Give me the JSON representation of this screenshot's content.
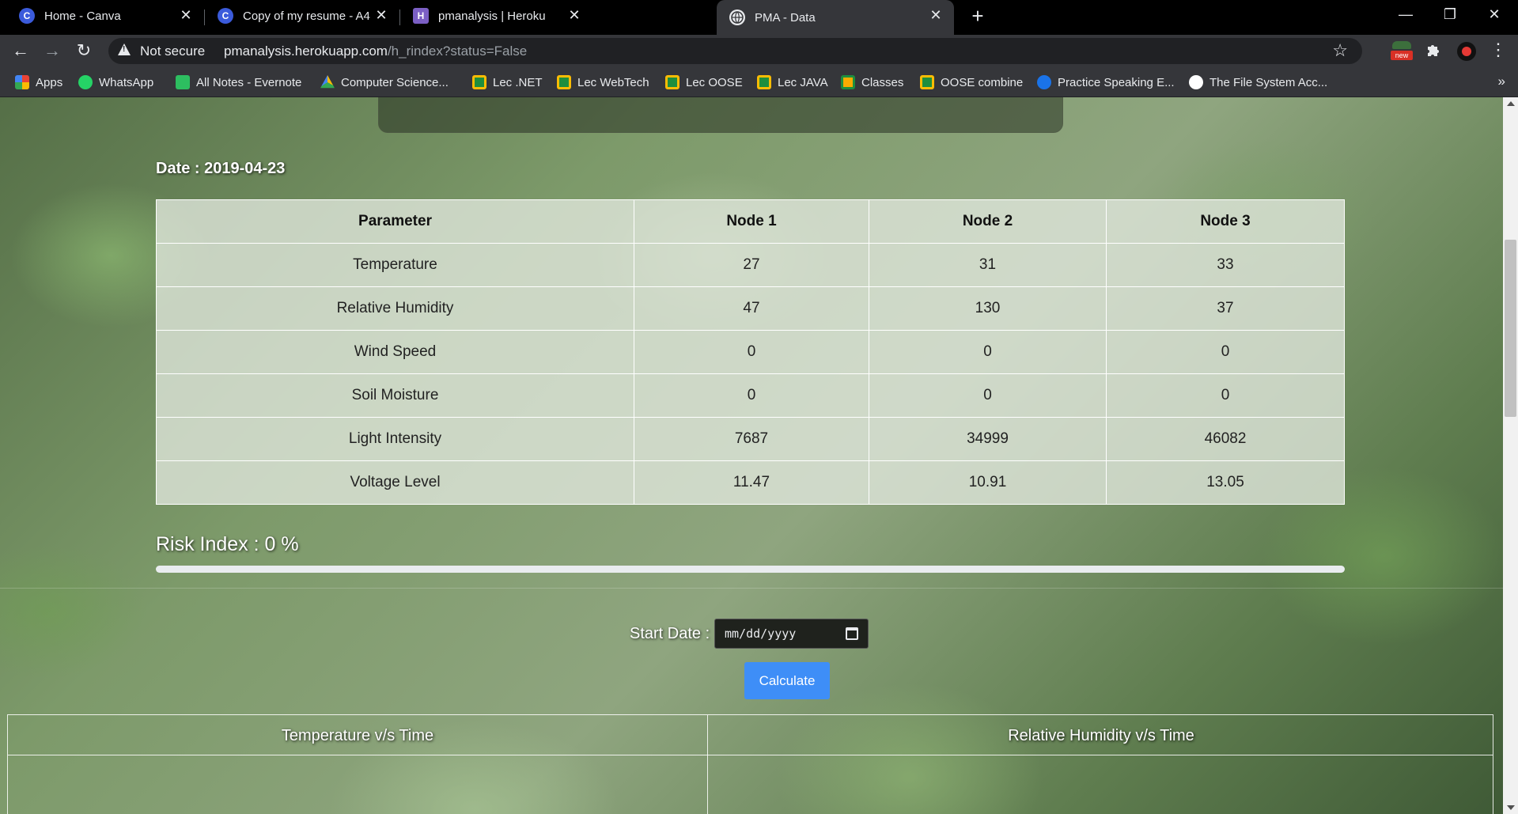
{
  "browser": {
    "tabs": [
      {
        "title": "Home - Canva",
        "favicon": "canva-icon",
        "color": "#3b5bdb",
        "letter": "C"
      },
      {
        "title": "Copy of my resume - A4",
        "favicon": "canva-icon",
        "color": "#3b5bdb",
        "letter": "C"
      },
      {
        "title": "pmanalysis | Heroku",
        "favicon": "heroku-icon",
        "color": "#7b5fc4",
        "letter": "H"
      },
      {
        "title": "PMA - Data",
        "favicon": "globe-icon",
        "color": "#5f6368",
        "letter": ""
      }
    ],
    "active_tab": 3,
    "security_label": "Not secure",
    "url_host": "pmanalysis.herokuapp.com",
    "url_path": "/h_rindex?status=False",
    "extension_badge": "new"
  },
  "bookmarks": [
    {
      "label": "Apps",
      "icon": "apps-grid-icon",
      "color": "#ea4335"
    },
    {
      "label": "WhatsApp",
      "icon": "whatsapp-icon",
      "color": "#25d366"
    },
    {
      "label": "All Notes - Evernote",
      "icon": "evernote-icon",
      "color": "#2dbe60"
    },
    {
      "label": "Computer Science...",
      "icon": "google-drive-icon",
      "color": "#fbbc04"
    },
    {
      "label": "Lec .NET",
      "icon": "classroom-icon",
      "color": "#1e8e3e"
    },
    {
      "label": "Lec WebTech",
      "icon": "classroom-icon",
      "color": "#1e8e3e"
    },
    {
      "label": "Lec OOSE",
      "icon": "classroom-icon",
      "color": "#1e8e3e"
    },
    {
      "label": "Lec JAVA",
      "icon": "classroom-icon",
      "color": "#1e8e3e"
    },
    {
      "label": "Classes",
      "icon": "classroom-icon",
      "color": "#f9ab00"
    },
    {
      "label": "OOSE combine",
      "icon": "classroom-icon",
      "color": "#1e8e3e"
    },
    {
      "label": "Practice Speaking E...",
      "icon": "globe-blue-icon",
      "color": "#1a73e8"
    },
    {
      "label": "The File System Acc...",
      "icon": "code-icon",
      "color": "#ffffff"
    }
  ],
  "page": {
    "date_label": "Date : 2019-04-23",
    "table": {
      "headers": [
        "Parameter",
        "Node 1",
        "Node 2",
        "Node 3"
      ],
      "rows": [
        [
          "Temperature",
          "27",
          "31",
          "33"
        ],
        [
          "Relative Humidity",
          "47",
          "130",
          "37"
        ],
        [
          "Wind Speed",
          "0",
          "0",
          "0"
        ],
        [
          "Soil Moisture",
          "0",
          "0",
          "0"
        ],
        [
          "Light Intensity",
          "7687",
          "34999",
          "46082"
        ],
        [
          "Voltage Level",
          "11.47",
          "10.91",
          "13.05"
        ]
      ]
    },
    "risk_label": "Risk Index : 0 %",
    "risk_value_percent": 0,
    "start_date_label": "Start Date :",
    "start_date_placeholder": "mm/dd/yyyy",
    "calculate_label": "Calculate",
    "chart_headers": [
      "Temperature v/s Time",
      "Relative Humidity v/s Time"
    ]
  }
}
